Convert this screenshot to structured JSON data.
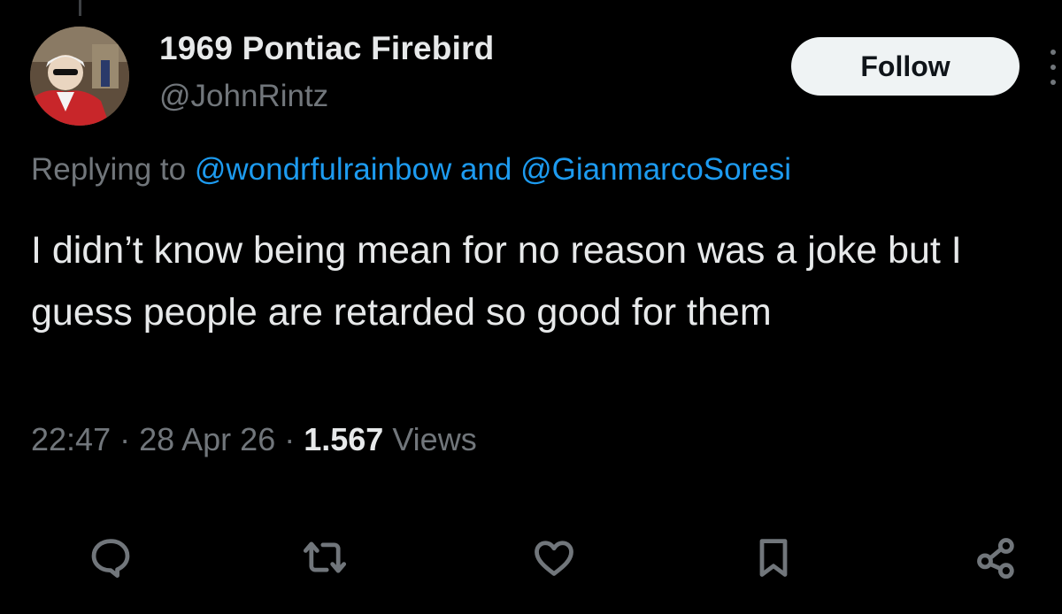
{
  "tweet": {
    "author": {
      "display_name": "1969 Pontiac Firebird",
      "handle": "@JohnRintz"
    },
    "follow_label": "Follow",
    "replying": {
      "prefix": "Replying to ",
      "mention_1": "@wondrfulrainbow",
      "conjunction": " and ",
      "mention_2": "@GianmarcoSoresi"
    },
    "text": "I didn’t know being mean for no reason was a joke but I guess people are retarded so good for them",
    "meta": {
      "time": "22:47",
      "sep1": " · ",
      "date": "28 Apr 26",
      "sep2": " · ",
      "views_count": "1.567",
      "views_label": " Views"
    },
    "actions": [
      {
        "icon": "reply-icon"
      },
      {
        "icon": "retweet-icon"
      },
      {
        "icon": "like-icon"
      },
      {
        "icon": "bookmark-icon"
      },
      {
        "icon": "share-icon"
      }
    ]
  },
  "colors": {
    "background": "#000000",
    "primary_text": "#e7e9ea",
    "secondary_text": "#71767b",
    "link": "#1d9bf0",
    "follow_bg": "#eff3f4"
  }
}
